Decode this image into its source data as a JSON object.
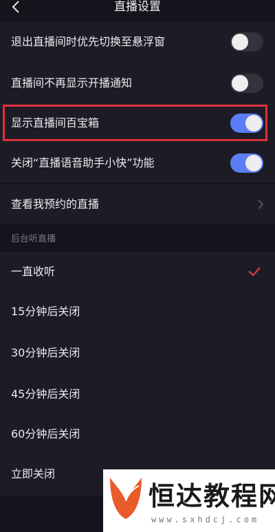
{
  "header": {
    "title": "直播设置",
    "back_icon": "chevron-left-icon"
  },
  "settings": {
    "items": [
      {
        "label": "退出直播间时优先切换至悬浮窗",
        "toggle": "off"
      },
      {
        "label": "直播间不再显示开播通知",
        "toggle": "off"
      },
      {
        "label": "显示直播间百宝箱",
        "toggle": "on"
      },
      {
        "label": "关闭“直播语音助手小快”功能",
        "toggle": "on"
      }
    ],
    "accent_color": "#5b7ef4",
    "highlight_color": "#e0323d"
  },
  "reservations": {
    "label": "查看我预约的直播"
  },
  "background_listen": {
    "title": "后台听直播",
    "options": [
      {
        "label": "一直收听",
        "selected": true
      },
      {
        "label": "15分钟后关闭",
        "selected": false
      },
      {
        "label": "30分钟后关闭",
        "selected": false
      },
      {
        "label": "45分钟后关闭",
        "selected": false
      },
      {
        "label": "60分钟后关闭",
        "selected": false
      },
      {
        "label": "立即关闭",
        "selected": false
      }
    ],
    "check_color": "#e5364a"
  },
  "watermark": {
    "name": "恒达教程网",
    "url": "www.sxhdcj.com"
  }
}
